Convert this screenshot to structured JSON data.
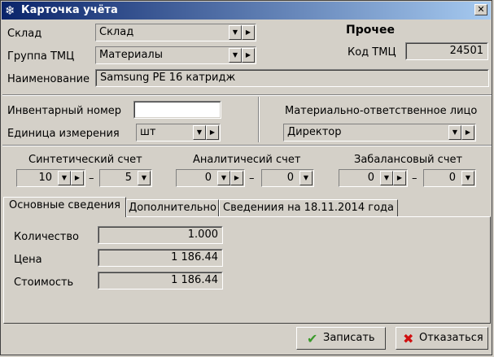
{
  "window": {
    "title": "Карточка учёта",
    "close_glyph": "✕"
  },
  "header": {
    "sklad_label": "Склад",
    "sklad_value": "Склад",
    "group_label": "Группа ТМЦ",
    "group_value": "Материалы",
    "name_label": "Наименование",
    "name_value": "Samsung PE 16 катридж",
    "other_title": "Прочее",
    "code_label": "Код ТМЦ",
    "code_value": "24501"
  },
  "details": {
    "inv_label": "Инвентарный номер",
    "inv_value": "",
    "unit_label": "Единица измерения",
    "unit_value": "шт",
    "mol_label": "Материально-ответственное лицо",
    "mol_value": "Директор"
  },
  "accounts": {
    "synthetic": {
      "label": "Синтетический счет",
      "v1": "10",
      "v2": "5"
    },
    "analytic": {
      "label": "Аналитичесий счет",
      "v1": "0",
      "v2": "0"
    },
    "offbalance": {
      "label": "Забалансовый счет",
      "v1": "0",
      "v2": "0"
    },
    "dash": "–"
  },
  "tabs": [
    {
      "label": "Основные сведения",
      "active": true
    },
    {
      "label": "Дополнительно",
      "active": false
    },
    {
      "label": "Сведениия на 18.11.2014 года",
      "active": false
    }
  ],
  "main_tab": {
    "qty_label": "Количество",
    "qty_value": "1.000",
    "price_label": "Цена",
    "price_value": "1 186.44",
    "cost_label": "Стоимость",
    "cost_value": "1 186.44"
  },
  "buttons": {
    "save": "Записать",
    "cancel": "Отказаться"
  },
  "icons": {
    "app": "snowflake-icon",
    "dropdown": "▼",
    "expand": "▶",
    "save": "✔",
    "cancel": "✖"
  },
  "colors": {
    "title_start": "#0a246a",
    "title_end": "#a6caf0",
    "save_icon": "#3a9a2a",
    "cancel_icon": "#d01010"
  }
}
